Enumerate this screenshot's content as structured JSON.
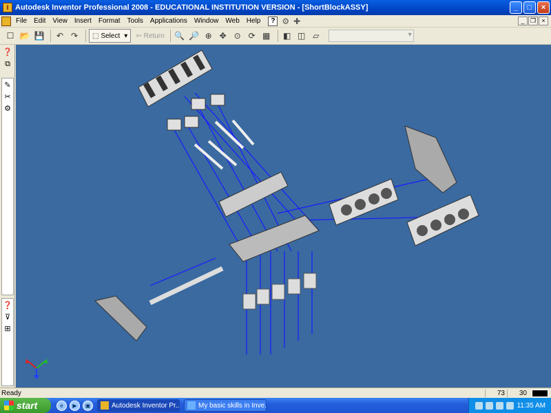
{
  "window": {
    "title": "Autodesk Inventor Professional 2008 - EDUCATIONAL INSTITUTION VERSION - [ShortBlockASSY]",
    "controls": [
      "_",
      "□",
      "×"
    ]
  },
  "menubar": {
    "items": [
      "File",
      "Edit",
      "View",
      "Insert",
      "Format",
      "Tools",
      "Applications",
      "Window",
      "Web",
      "Help"
    ],
    "help_button": "?"
  },
  "toolbar": {
    "select_label": "Select",
    "return_label": "Return"
  },
  "viewport": {
    "background": "#3a6aa0",
    "wire_color": "#1a1aff",
    "triad": {
      "x_color": "#e02020",
      "y_color": "#20c020",
      "z_color": "#2040ff"
    }
  },
  "statusbar": {
    "text": "Ready",
    "value1": "73",
    "value2": "30"
  },
  "taskbar": {
    "start_label": "start",
    "tasks": [
      "Autodesk Inventor Pr...",
      "My basic skills in Inve..."
    ],
    "clock": "11:35 AM"
  }
}
